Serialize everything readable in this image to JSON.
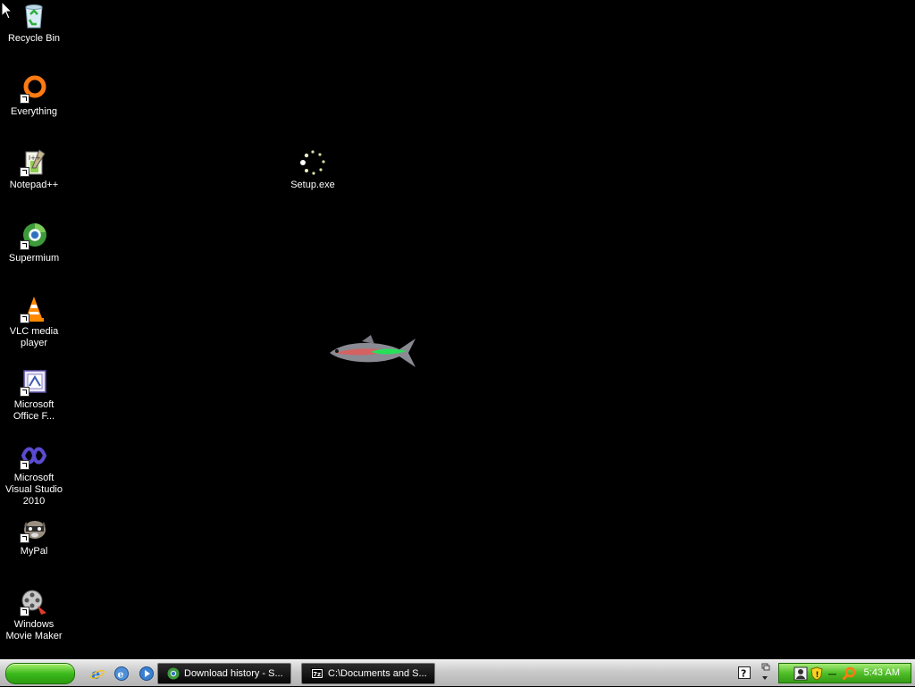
{
  "desktop": {
    "icons": [
      {
        "label": "Recycle Bin",
        "icon": "recycle-bin-icon"
      },
      {
        "label": "Everything",
        "icon": "everything-search-icon"
      },
      {
        "label": "Notepad++",
        "icon": "notepad-plus-plus-icon"
      },
      {
        "label": "Supermium",
        "icon": "supermium-browser-icon"
      },
      {
        "label": "VLC media player",
        "icon": "vlc-cone-icon"
      },
      {
        "label": "Microsoft Office F...",
        "icon": "office-frontpage-icon"
      },
      {
        "label": "Microsoft Visual Studio 2010",
        "icon": "visual-studio-icon"
      },
      {
        "label": "MyPal",
        "icon": "mypal-raccoon-icon"
      },
      {
        "label": "Windows Movie Maker",
        "icon": "movie-maker-icon"
      },
      {
        "label": "Setup.exe",
        "icon": "loading-spinner-icon"
      }
    ],
    "wallpaper": "aquarium-fish"
  },
  "taskbar": {
    "quick_launch": [
      "internet-explorer-icon",
      "ie-alt-icon",
      "media-player-icon"
    ],
    "tasks": [
      {
        "label": "Download history - S...",
        "icon": "supermium-browser-icon"
      },
      {
        "label": "C:\\Documents and S...",
        "icon": "7zip-icon"
      }
    ],
    "tray": {
      "icons": [
        "user-icon",
        "security-shield-icon",
        "dash-icon",
        "search-icon"
      ],
      "clock": "5:43 AM"
    }
  },
  "colors": {
    "desktop_bg": "#000000",
    "start_green": "#3cba1d",
    "taskbar": "#c9c9c9"
  }
}
